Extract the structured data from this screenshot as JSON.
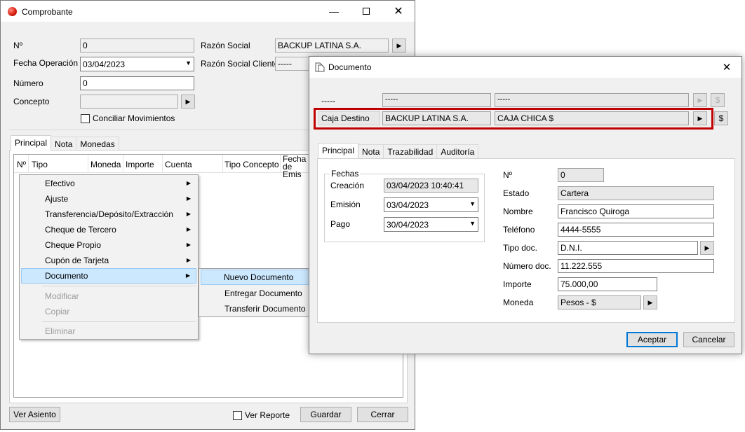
{
  "comprobante": {
    "title": "Comprobante",
    "labels": {
      "numero_sym": "Nº",
      "fecha_operacion": "Fecha Operación",
      "numero": "Número",
      "concepto": "Concepto",
      "razon_social": "Razón Social",
      "razon_social_cliente": "Razón Social Cliente"
    },
    "values": {
      "numero_sym": "0",
      "fecha_operacion": "03/04/2023",
      "numero": "0",
      "concepto": "",
      "razon_social": "BACKUP LATINA S.A.",
      "razon_social_cliente": "-----"
    },
    "conciliar_label": "Conciliar Movimientos",
    "tabs": [
      "Principal",
      "Nota",
      "Monedas"
    ],
    "grid_headers": [
      "Nº",
      "Tipo",
      "Moneda",
      "Importe",
      "Cuenta",
      "Tipo Concepto",
      "Fecha de Emis"
    ],
    "footer": {
      "ver_asiento": "Ver Asiento",
      "ver_reporte": "Ver Reporte",
      "guardar": "Guardar",
      "cerrar": "Cerrar"
    }
  },
  "context_menu": {
    "items": [
      "Efectivo",
      "Ajuste",
      "Transferencia/Depósito/Extracción",
      "Cheque de Tercero",
      "Cheque Propio",
      "Cupón de Tarjeta",
      "Documento"
    ],
    "disabled": [
      "Modificar",
      "Copiar",
      "Eliminar"
    ],
    "submenu": [
      "Nuevo Documento",
      "Entregar Documento",
      "Transferir Documento"
    ]
  },
  "documento": {
    "title": "Documento",
    "top_rows": [
      {
        "label": "-----",
        "a": "-----",
        "b": "-----"
      },
      {
        "label": "Caja Destino",
        "a": "BACKUP LATINA S.A.",
        "b": "CAJA CHICA $"
      }
    ],
    "tabs": [
      "Principal",
      "Nota",
      "Trazabilidad",
      "Auditoría"
    ],
    "fechas": {
      "title": "Fechas",
      "creacion_label": "Creación",
      "creacion": "03/04/2023 10:40:41",
      "emision_label": "Emisión",
      "emision": "03/04/2023",
      "pago_label": "Pago",
      "pago": "30/04/2023"
    },
    "fields": {
      "numero_label": "Nº",
      "numero": "0",
      "estado_label": "Estado",
      "estado": "Cartera",
      "nombre_label": "Nombre",
      "nombre": "Francisco Quiroga",
      "telefono_label": "Teléfono",
      "telefono": "4444-5555",
      "tipo_doc_label": "Tipo doc.",
      "tipo_doc": "D.N.I.",
      "numero_doc_label": "Número doc.",
      "numero_doc": "11.222.555",
      "importe_label": "Importe",
      "importe": "75.000,00",
      "moneda_label": "Moneda",
      "moneda": "Pesos - $"
    },
    "buttons": {
      "aceptar": "Aceptar",
      "cancelar": "Cancelar"
    },
    "dollar": "$",
    "highlight_color": "#c00000"
  }
}
